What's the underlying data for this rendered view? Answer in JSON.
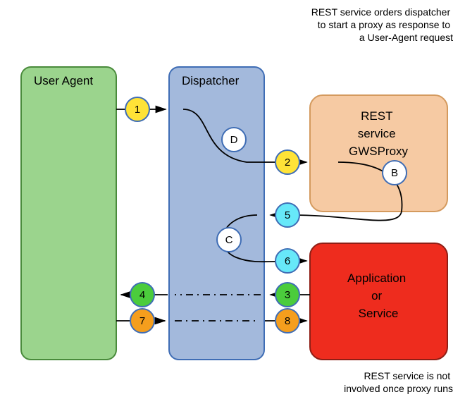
{
  "note_top": "REST service orders dispatcher to start a proxy as response to a User-Agent request",
  "note_bottom": "REST service is not involved once proxy runs",
  "boxes": {
    "user_agent": {
      "label": "User Agent"
    },
    "dispatcher": {
      "label": "Dispatcher"
    },
    "rest": {
      "line1": "REST",
      "line2": "service",
      "line3": "GWSProxy"
    },
    "app": {
      "line1": "Application",
      "line2": "or",
      "line3": "Service"
    }
  },
  "circles": {
    "c1": "1",
    "c2": "2",
    "c3": "3",
    "c4": "4",
    "c5": "5",
    "c6": "6",
    "c7": "7",
    "c8": "8",
    "cD": "D",
    "cB": "B",
    "cC": "C"
  }
}
